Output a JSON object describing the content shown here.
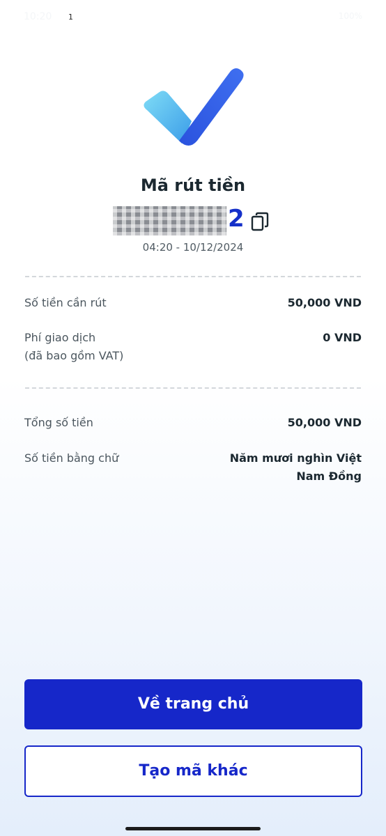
{
  "status_bar": {
    "time": "10:20",
    "notification_count": "1",
    "right_info": "100%"
  },
  "receipt": {
    "title": "Mã rút tiền",
    "code_visible_suffix": "2",
    "timestamp": "04:20 - 10/12/2024"
  },
  "details": {
    "amount": {
      "label": "Số tiền cần rút",
      "value": "50,000 VND"
    },
    "fee": {
      "label_line1": "Phí giao dịch",
      "label_line2": "(đã bao gồm VAT)",
      "value": "0 VND"
    },
    "total": {
      "label": "Tổng số tiền",
      "value": "50,000 VND"
    },
    "in_words": {
      "label": "Số tiền bằng chữ",
      "value_line1": "Năm mươi nghìn Việt",
      "value_line2": "Nam Đồng"
    }
  },
  "actions": {
    "home_button": "Về trang chủ",
    "new_code_button": "Tạo mã khác"
  },
  "colors": {
    "primary": "#1627c9",
    "check_light": "#5cc6f0",
    "check_dark": "#2a55e0"
  }
}
